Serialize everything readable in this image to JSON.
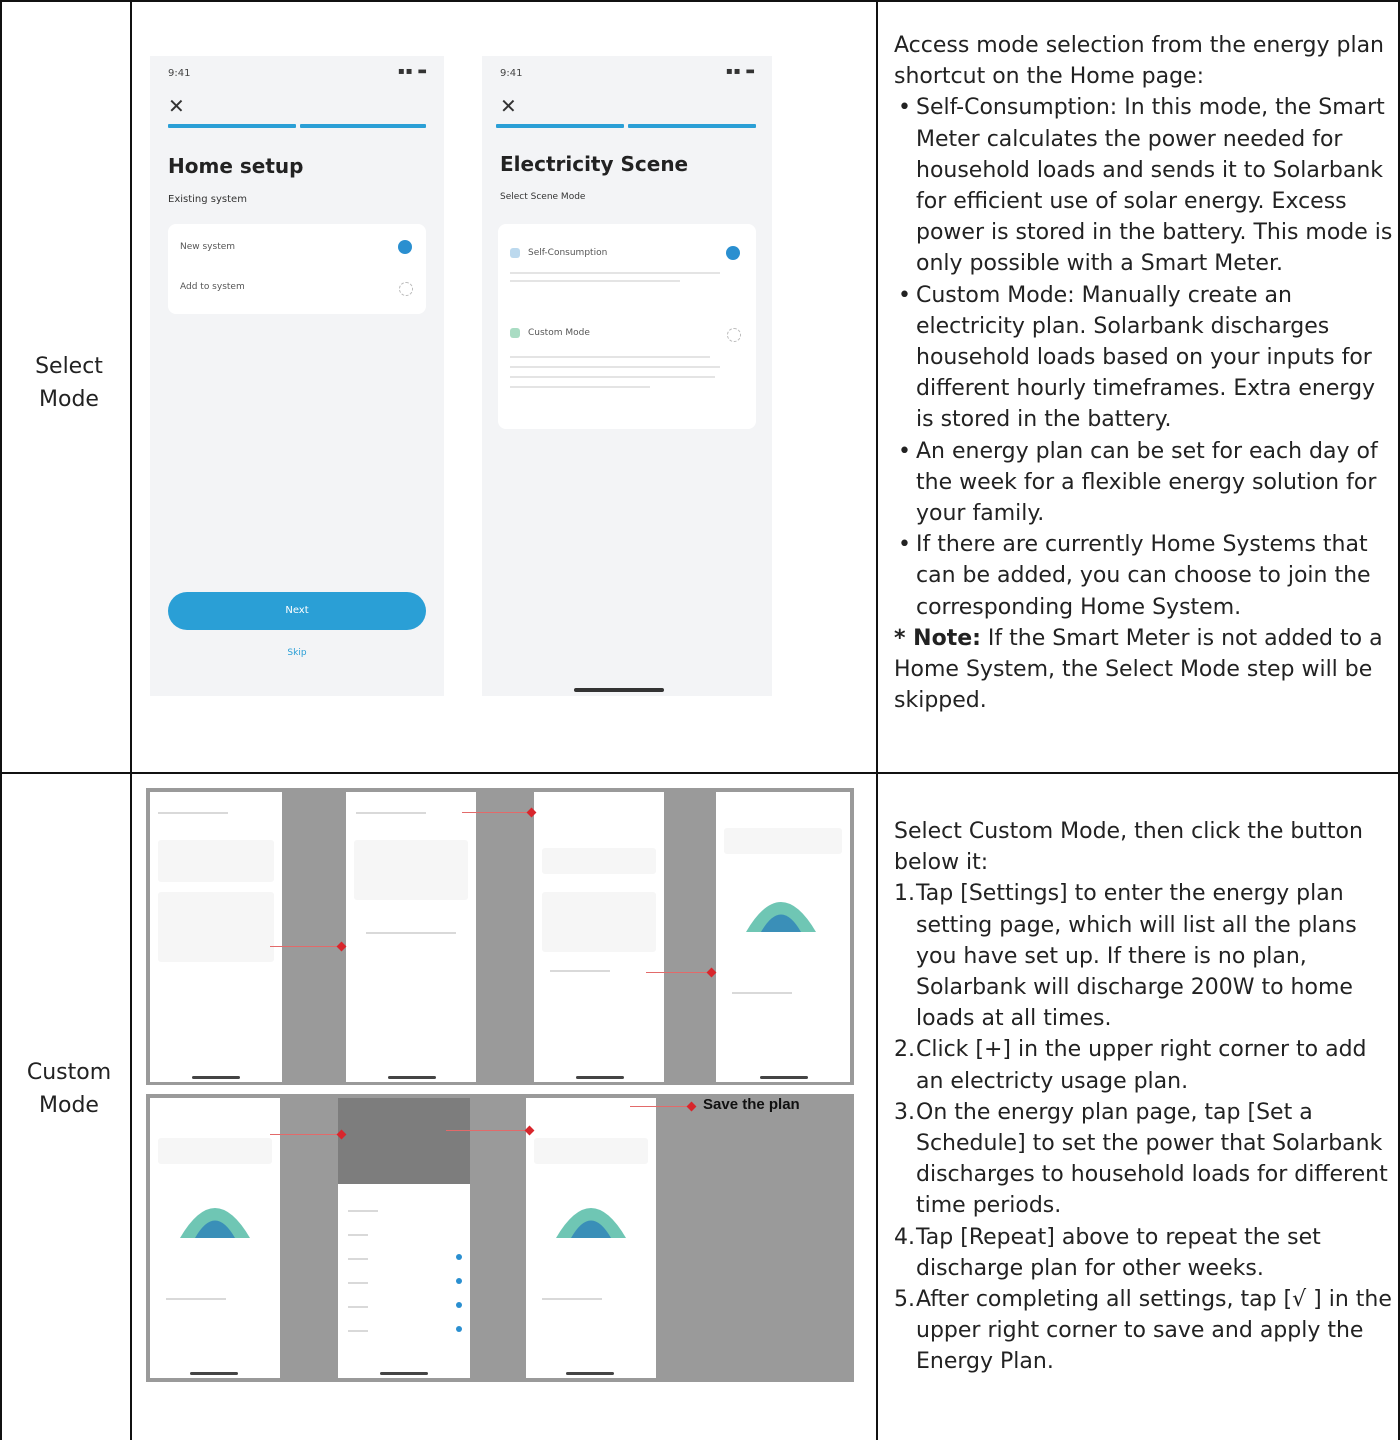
{
  "rows": [
    {
      "label": "Select\nMode",
      "phone1": {
        "status_time": "9:41",
        "title": "Home setup",
        "subtitle": "Existing system",
        "option1": "New system",
        "option2": "Add to system",
        "button": "Next",
        "link": "Skip"
      },
      "phone2": {
        "status_time": "9:41",
        "title": "Electricity Scene",
        "subtitle": "Select Scene Mode",
        "option1": "Self-Consumption",
        "option2": "Custom Mode"
      },
      "description": {
        "intro": "Access mode selection from the energy plan shortcut on the Home page:",
        "bullets": [
          "Self-Consumption: In this mode, the Smart Meter calculates the power needed for household loads and sends it to Solarbank for efficient use of solar energy. Excess power is stored in the battery. This mode is only possible with a Smart Meter.",
          "Custom Mode: Manually create an electricity plan. Solarbank discharges household loads based on your inputs for different hourly timeframes. Extra energy is stored in the battery.",
          "An energy plan can be set for each day of the week for a flexible energy solution for your family.",
          "If there are currently Home Systems that can be added, you can choose to join the corresponding Home System."
        ],
        "note_label": "* Note:",
        "note_text": " If the Smart Meter is not added to a Home System, the Select Mode step will be skipped."
      }
    },
    {
      "label": "Custom\nMode",
      "save_label": "Save the plan",
      "description": {
        "intro": "Select Custom Mode, then click the button below it:",
        "steps": [
          {
            "num": "1.",
            "text": "Tap [Settings] to enter the energy plan setting page, which will list all the plans you have set up. If there is no plan, Solarbank will discharge 200W to home loads at all times."
          },
          {
            "num": "2.",
            "text": "Click [+] in the upper right corner to add an electricty usage plan."
          },
          {
            "num": "3.",
            "text": "On the energy plan page, tap [Set a Schedule] to set the power that Solarbank discharges to household loads for different time periods."
          },
          {
            "num": "4.",
            "text": " Tap [Repeat] above to repeat the set discharge plan for other weeks."
          },
          {
            "num": "5.",
            "text": " After completing all settings, tap [√ ] in the upper right corner to save and apply the Energy Plan."
          }
        ]
      }
    }
  ],
  "colors": {
    "accent": "#2a9fd6",
    "arrow": "#d8262c",
    "border": "#111111"
  }
}
